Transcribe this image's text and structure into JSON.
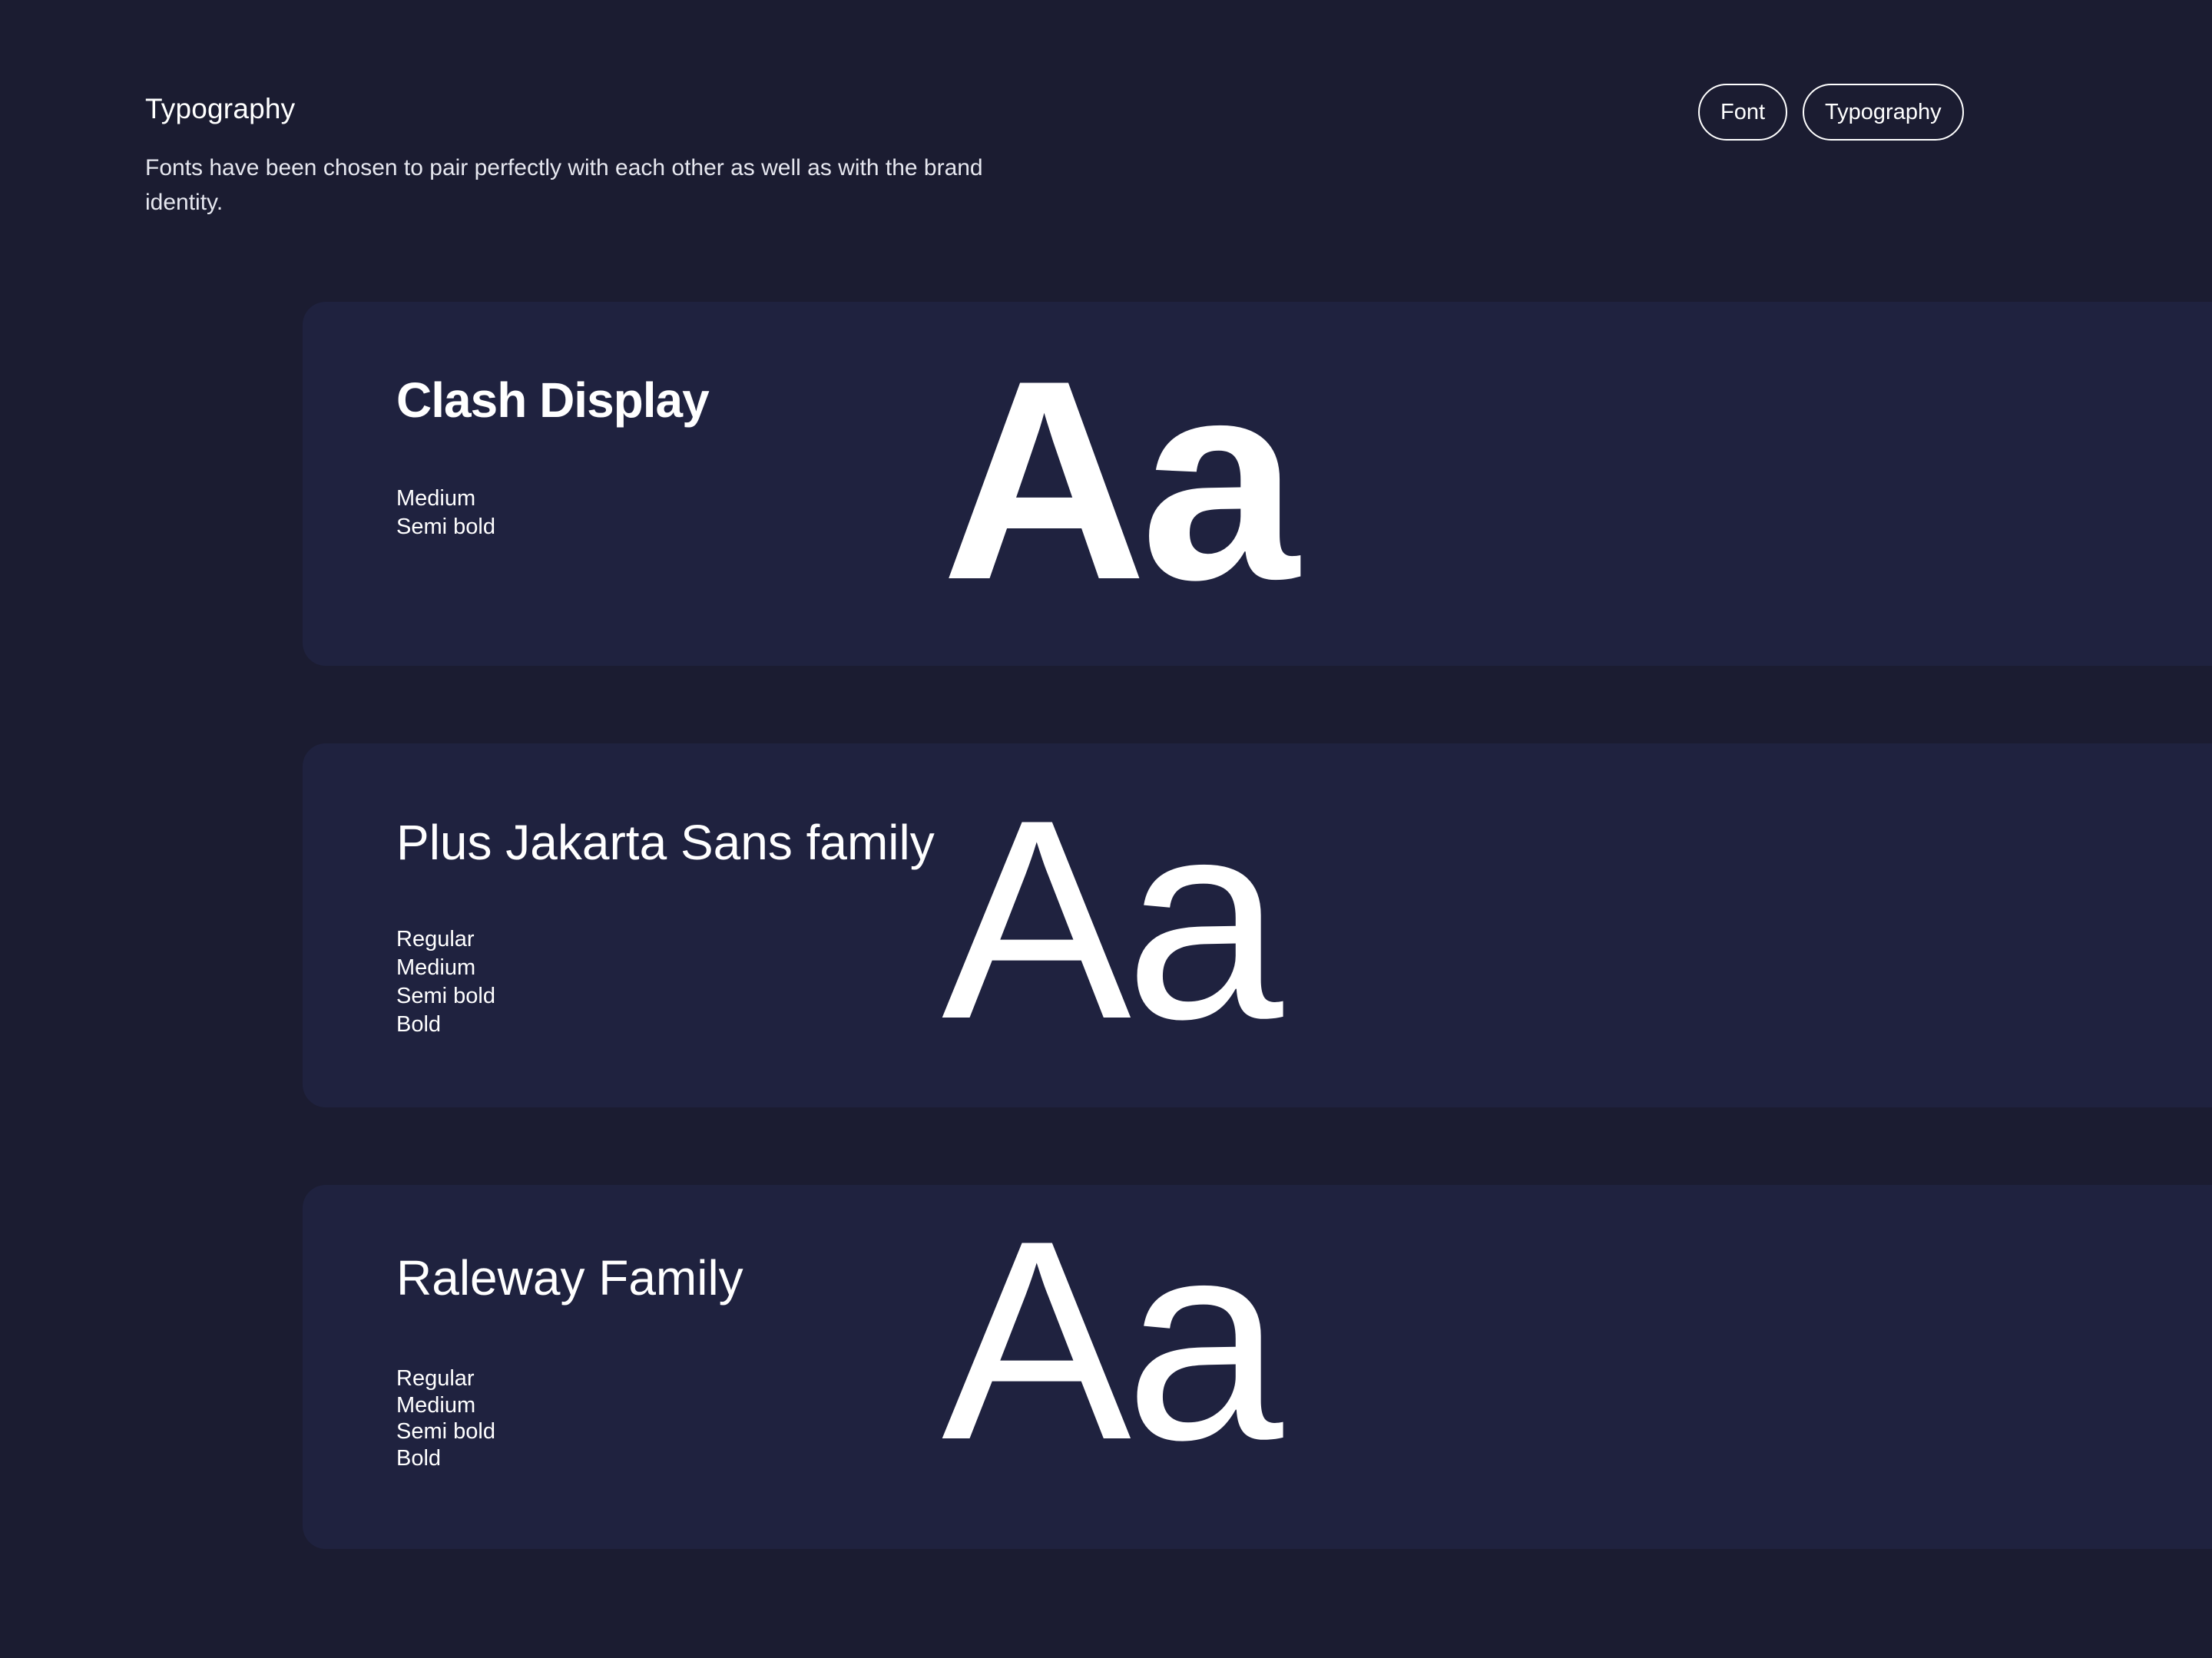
{
  "header": {
    "title": "Typography",
    "description": "Fonts have been chosen to pair perfectly with each other as well as with the brand identity."
  },
  "tags": [
    {
      "label": "Font"
    },
    {
      "label": "Typography"
    }
  ],
  "fonts": [
    {
      "name": "Clash Display",
      "weights": [
        "Medium",
        "Semi bold"
      ],
      "specimen": "Aa"
    },
    {
      "name": "Plus Jakarta Sans family",
      "weights": [
        "Regular",
        "Medium",
        "Semi bold",
        "Bold"
      ],
      "specimen": "Aa"
    },
    {
      "name": "Raleway Family",
      "weights": [
        "Regular",
        "Medium",
        "Semi bold",
        "Bold"
      ],
      "specimen": "Aa"
    }
  ],
  "colors": {
    "background": "#1b1c31",
    "card": "#1f223f",
    "text": "#ffffff"
  }
}
